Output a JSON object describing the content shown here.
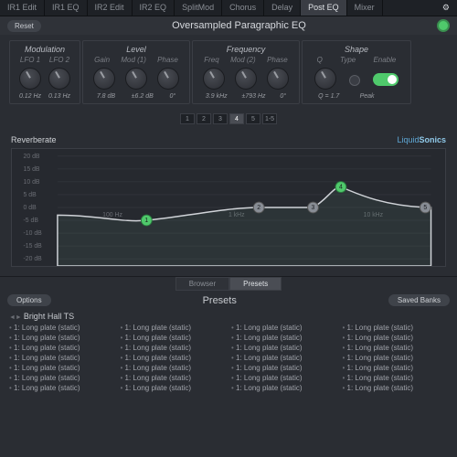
{
  "tabs": [
    "IR1 Edit",
    "IR1 EQ",
    "IR2 Edit",
    "IR2 EQ",
    "SplitMod",
    "Chorus",
    "Delay",
    "Post EQ",
    "Mixer"
  ],
  "activeTab": 7,
  "reset": "Reset",
  "title": "Oversampled Paragraphic EQ",
  "groups": {
    "mod": {
      "title": "Modulation",
      "labels": [
        "LFO 1",
        "LFO 2"
      ],
      "vals": [
        "0.12 Hz",
        "0.13 Hz"
      ]
    },
    "level": {
      "title": "Level",
      "labels": [
        "Gain",
        "Mod (1)",
        "Phase"
      ],
      "vals": [
        "7.8 dB",
        "±6.2 dB",
        "0°"
      ]
    },
    "freq": {
      "title": "Frequency",
      "labels": [
        "Freq",
        "Mod (2)",
        "Phase"
      ],
      "vals": [
        "3.9 kHz",
        "±793 Hz",
        "0°"
      ]
    },
    "shape": {
      "title": "Shape",
      "labels": [
        "Q",
        "Type",
        "Enable"
      ],
      "vals": [
        "Q = 1.7",
        "Peak",
        ""
      ]
    }
  },
  "bands": [
    "1",
    "2",
    "3",
    "4",
    "5",
    "1-5"
  ],
  "activeBand": 3,
  "graphTitle": "Reverberate",
  "brand": {
    "a": "Liquid",
    "b": "Sonics"
  },
  "yticks": [
    "20 dB",
    "15 dB",
    "10 dB",
    "5 dB",
    "0 dB",
    "-5 dB",
    "-10 dB",
    "-15 dB",
    "-20 dB"
  ],
  "xticks": [
    "100 Hz",
    "1 kHz",
    "10 kHz"
  ],
  "chart_data": {
    "type": "line",
    "xscale": "log",
    "ylabel": "dB",
    "ylim": [
      -20,
      20
    ],
    "nodes": [
      {
        "id": 1,
        "freq": 180,
        "gain": -5
      },
      {
        "id": 2,
        "freq": 1200,
        "gain": 0
      },
      {
        "id": 3,
        "freq": 3000,
        "gain": 0
      },
      {
        "id": 4,
        "freq": 4800,
        "gain": 8
      },
      {
        "id": 5,
        "freq": 20000,
        "gain": 0
      }
    ]
  },
  "browserTabs": [
    "Browser",
    "Presets"
  ],
  "activeBrowser": 1,
  "options": "Options",
  "presetsTitle": "Presets",
  "savedBanks": "Saved Banks",
  "currentPreset": "Bright Hall TS",
  "presetItem": "1: Long plate (static)",
  "presetCount": 28
}
